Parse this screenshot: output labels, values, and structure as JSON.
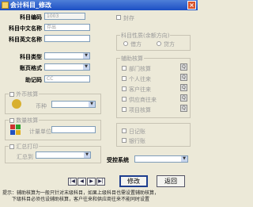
{
  "window": {
    "title": "会计科目_修改",
    "close_glyph": "×"
  },
  "form": {
    "code_label": "科目编码",
    "code_value": "1003",
    "cn_name_label": "科目中文名称",
    "cn_name_value": "存出",
    "en_name_label": "科目英文名称",
    "en_name_value": "",
    "type_label": "科目类型",
    "type_value": "",
    "format_label": "账页格式",
    "format_value": "",
    "mnemonic_label": "助记码",
    "mnemonic_value": "CC"
  },
  "foreign": {
    "title": "外币核算",
    "currency_label": "币种"
  },
  "quantity": {
    "title": "数量核算",
    "unit_label": "计量单位"
  },
  "summary": {
    "title": "汇总打印",
    "to_label": "汇总到"
  },
  "sealed": {
    "label": "封存"
  },
  "direction": {
    "title": "科目性质(余额方向)",
    "debit": "借方",
    "credit": "贷方"
  },
  "assist": {
    "title": "辅助核算",
    "items": [
      "部门核算",
      "个人往来",
      "客户往来",
      "供应商往来",
      "项目核算"
    ]
  },
  "books": {
    "journal": "日记账",
    "bank": "银行账"
  },
  "control": {
    "label": "受控系统"
  },
  "nav": [
    "|◀",
    "◀",
    "▶",
    "▶|"
  ],
  "buttons": {
    "modify": "修改",
    "back": "返回"
  },
  "hint": {
    "line1": "提示：辅助核算为一般只针对末级科目，如果上级科目也需设置辅助核算，",
    "line2": "　　下级科目必须也设辅助核算，客户往来和供应商往来不能同时设置"
  }
}
